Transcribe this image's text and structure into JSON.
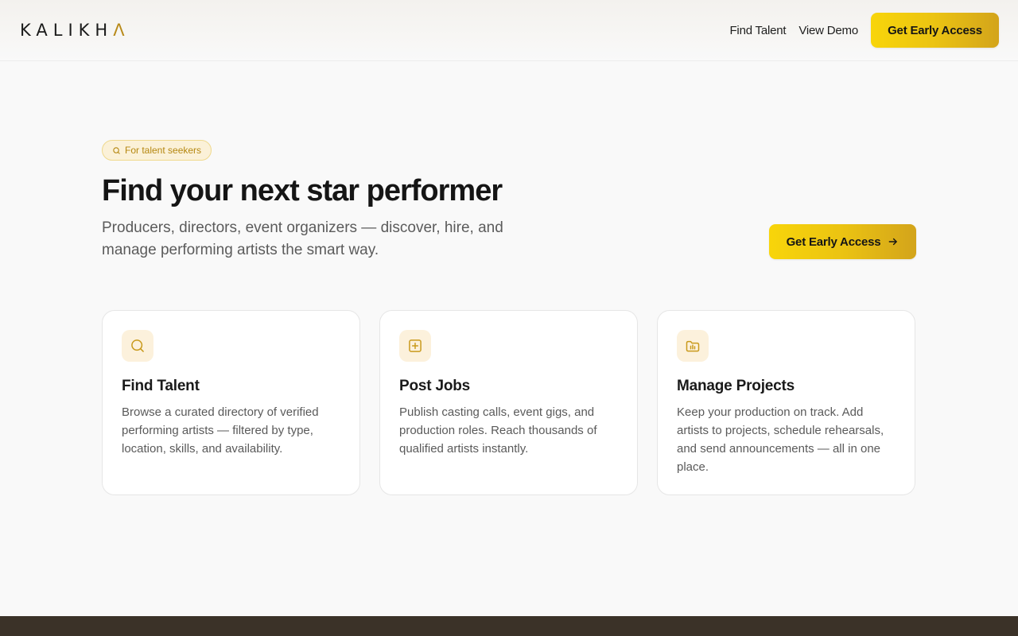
{
  "brand": {
    "logo_main": "KALIKH",
    "logo_accent": "Λ",
    "accent_color": "#b88a1a"
  },
  "nav": {
    "find_talent": "Find Talent",
    "view_demo": "View Demo",
    "cta": "Get Early Access"
  },
  "hero": {
    "badge": "For talent seekers",
    "title": "Find your next star performer",
    "subtitle": "Producers, directors, event organizers — discover, hire, and manage performing artists the smart way.",
    "cta": "Get Early Access"
  },
  "cards": [
    {
      "icon": "search-icon",
      "title": "Find Talent",
      "body": "Browse a curated directory of verified performing artists — filtered by type, location, skills, and availability."
    },
    {
      "icon": "plus-square-icon",
      "title": "Post Jobs",
      "body": "Publish casting calls, event gigs, and production roles. Reach thousands of qualified artists instantly."
    },
    {
      "icon": "folder-icon",
      "title": "Manage Projects",
      "body": "Keep your production on track. Add artists to projects, schedule rehearsals, and send announcements — all in one place."
    }
  ],
  "colors": {
    "primary": "#f8d50a",
    "primary_dark": "#d3a41b",
    "badge_bg": "#fbf1d8",
    "footer": "#3b3228"
  }
}
